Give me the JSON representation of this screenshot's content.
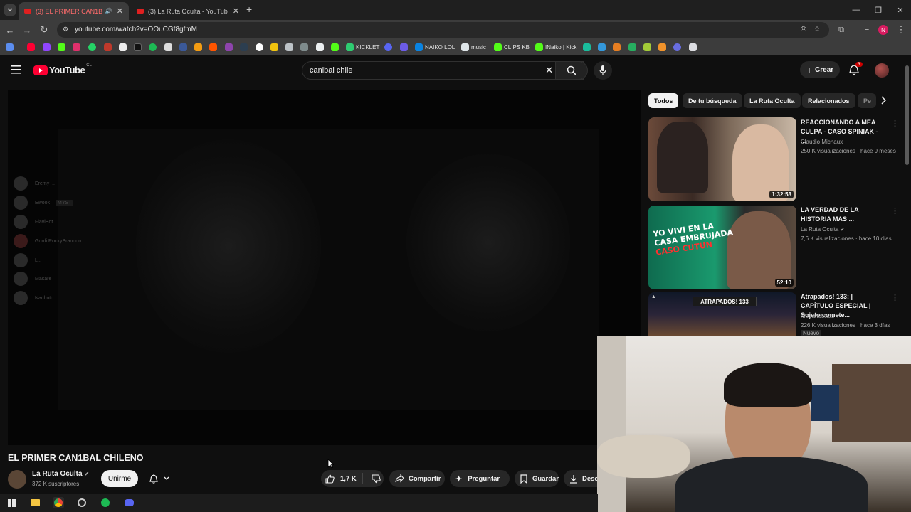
{
  "browser": {
    "tabs": [
      {
        "title": "(3) EL PRIMER CAN1BAL CH",
        "active": true
      },
      {
        "title": "(3) La Ruta Oculta - YouTube",
        "active": false
      }
    ],
    "url": "youtube.com/watch?v=OOuCGf8gfmM",
    "profile_initial": "N",
    "bookmarks": [
      "KICKLET",
      "NAIKO LOL",
      "music",
      "CLIPS KB",
      "INaiko | Kick"
    ]
  },
  "youtube": {
    "logo_text": "YouTube",
    "country": "CL",
    "search_query": "canibal chile",
    "create_label": "Crear",
    "notification_count": "3"
  },
  "player": {
    "discord_users": [
      "Eremy_..",
      "Ewook",
      "FlaviBot",
      "Gordi RockyBrandon",
      "L..",
      "Masare",
      "Nachuto"
    ],
    "discord_tag": "MYST"
  },
  "video": {
    "title": "EL PRIMER CAN1BAL CHILENO",
    "channel": "La Ruta Oculta",
    "subscribers": "372 K suscriptores",
    "join_label": "Unirme",
    "likes": "1,7 K",
    "share_label": "Compartir",
    "ask_label": "Preguntar",
    "save_label": "Guardar",
    "download_label": "Desc"
  },
  "sidebar": {
    "chips": [
      "Todos",
      "De tu búsqueda",
      "La Ruta Oculta",
      "Relacionados",
      "Pe"
    ],
    "videos": [
      {
        "title": "REACCIONANDO A MEA CULPA - CASO SPINIAK - ...",
        "channel": "Claudio Michaux",
        "meta": "250 K visualizaciones · hace 9 meses",
        "duration": "1:32:53"
      },
      {
        "title": "LA VERDAD DE LA HISTORIA MAS ...",
        "channel": "La Ruta Oculta",
        "meta": "7,6 K visualizaciones · hace 10 días",
        "duration": "52:10",
        "thumb_text_1": "YO VIVI EN LA",
        "thumb_text_2": "CASA EMBRUJADA",
        "thumb_text_3": "CASO CUTUN"
      },
      {
        "title": "Atrapados! 133: | CAPÍTULO ESPECIAL | Sujeto comete...",
        "channel": "Meganoticias",
        "meta": "226 K visualizaciones · hace 3 días",
        "badge": "Nuevo",
        "thumb_text_1": "ATRAPADOS! 133"
      }
    ]
  },
  "colors": {
    "yt_red": "#ff0033",
    "bg": "#0f0f0f",
    "chip_bg": "#272727"
  }
}
